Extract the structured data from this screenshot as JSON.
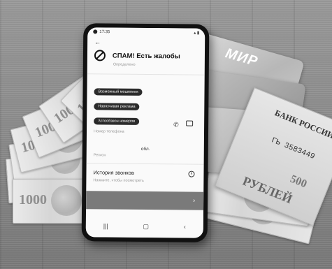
{
  "status_bar": {
    "time": "17:35"
  },
  "screen": {
    "back_icon": "arrow-left-icon",
    "title": "СПАМ! Есть жалобы",
    "subtitle": "Определено",
    "tags": [
      "Возможный мошенник",
      "Навязчивая реклама",
      "Автообзвон номеров"
    ],
    "phone_number": "+7 9",
    "phone_label": "Номер телефона",
    "region_value": "обл.",
    "region_label": "Регион",
    "history_title": "История звонков",
    "history_hint": "Нажмите, чтобы посмотреть",
    "action_icon": "chevron-right-icon",
    "nav_icons": [
      "recents-icon",
      "home-icon",
      "back-icon"
    ]
  },
  "background": {
    "card_brand": "МИР",
    "banknote_value": "1000",
    "big_note_bank": "БАНК РОССИИ",
    "big_note_serial": "ГЬ 3583449",
    "big_note_nominal": "500",
    "big_note_currency": "РУБЛЕЙ"
  }
}
